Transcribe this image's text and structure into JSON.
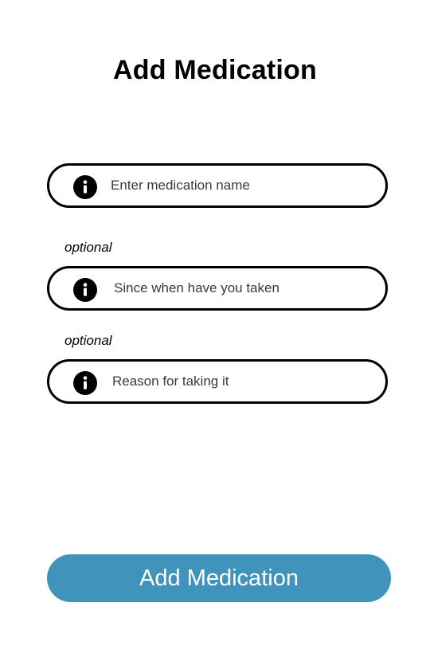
{
  "header": {
    "title": "Add Medication"
  },
  "fields": [
    {
      "icon": "info-icon",
      "placeholder": "Enter medication name",
      "value": ""
    },
    {
      "hint": "optional",
      "icon": "info-icon",
      "placeholder": "Since when have you taken",
      "value": ""
    },
    {
      "hint": "optional",
      "icon": "info-icon",
      "placeholder": "Reason for taking it",
      "value": ""
    }
  ],
  "actions": {
    "submit_label": "Add Medication"
  },
  "colors": {
    "accent": "#4093bb",
    "border": "#000000",
    "background": "#ffffff"
  }
}
